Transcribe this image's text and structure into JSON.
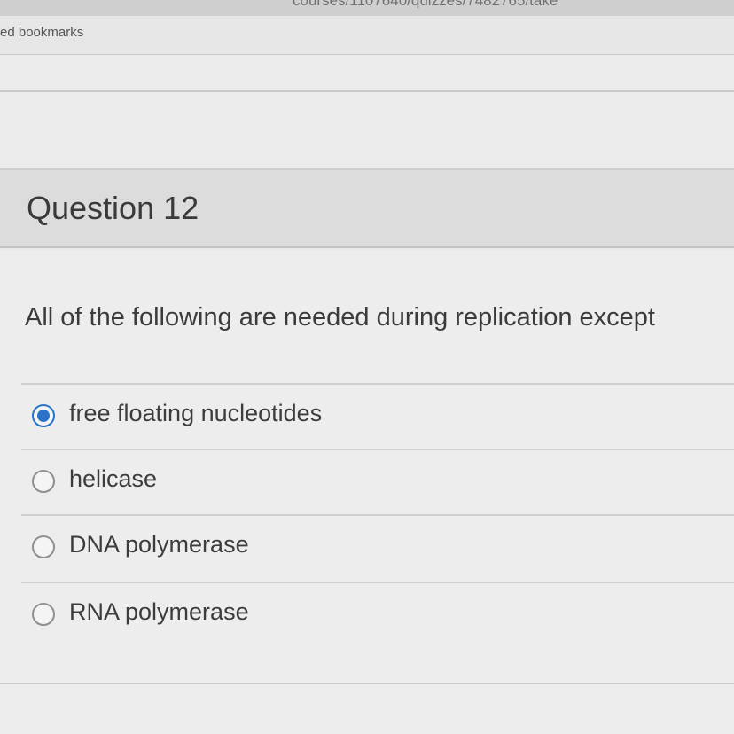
{
  "browser": {
    "url_fragment": "courses/1107640/quizzes/7482765/take",
    "bookmarks_label": "ed bookmarks"
  },
  "quiz": {
    "question_title": "Question 12",
    "question_text": "All of the following are needed during replication except",
    "answers": [
      {
        "label": "free floating nucleotides",
        "selected": true
      },
      {
        "label": "helicase",
        "selected": false
      },
      {
        "label": "DNA polymerase",
        "selected": false
      },
      {
        "label": "RNA polymerase",
        "selected": false
      }
    ]
  },
  "colors": {
    "selected_radio": "#2b73c8",
    "header_bg": "#dcdcdc"
  }
}
